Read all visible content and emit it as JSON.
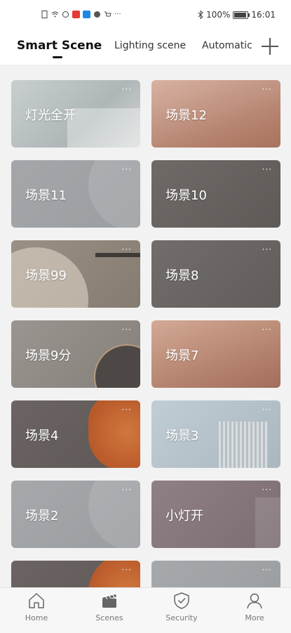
{
  "status_bar": {
    "battery": "100%",
    "time": "16:01",
    "icons": [
      "file-icon",
      "wifi-icon",
      "settings-icon",
      "red-app-icon",
      "blue-app-icon",
      "globe-icon",
      "cart-icon",
      "more-icon",
      "bluetooth-icon"
    ]
  },
  "tabs": [
    {
      "label": "Smart Scene",
      "active": true
    },
    {
      "label": "Lighting scene",
      "active": false
    },
    {
      "label": "Automatic",
      "active": false
    }
  ],
  "cards": [
    {
      "label": "灯光全开",
      "more": "···",
      "bg": "#b9c0c2"
    },
    {
      "label": "场景12",
      "more": "···",
      "bg": "#b88a77"
    },
    {
      "label": "场景11",
      "more": "···",
      "bg": "#9a9ea1"
    },
    {
      "label": "场景10",
      "more": "···",
      "bg": "#66615e"
    },
    {
      "label": "场景99",
      "more": "···",
      "bg": "#8d8378"
    },
    {
      "label": "场景8",
      "more": "···",
      "bg": "#6a6664"
    },
    {
      "label": "场景9分",
      "more": "···",
      "bg": "#8e8985"
    },
    {
      "label": "场景7",
      "more": "···",
      "bg": "#b58b78"
    },
    {
      "label": "场景4",
      "more": "···",
      "bg": "#6b6462"
    },
    {
      "label": "场景3",
      "more": "···",
      "bg": "#b4c2ca"
    },
    {
      "label": "场景2",
      "more": "···",
      "bg": "#a2a6a9"
    },
    {
      "label": "小灯开",
      "more": "···",
      "bg": "#8a7b80"
    },
    {
      "label": "",
      "more": "···",
      "bg": "#6b6462"
    },
    {
      "label": "",
      "more": "···",
      "bg": "#a2a6a9"
    }
  ],
  "bottom_nav": [
    {
      "label": "Home",
      "icon": "home-icon"
    },
    {
      "label": "Scenes",
      "icon": "scenes-icon"
    },
    {
      "label": "Security",
      "icon": "security-shield-icon"
    },
    {
      "label": "More",
      "icon": "person-icon"
    }
  ],
  "colors": {
    "accent": "#111111",
    "background": "#f2f2f2"
  }
}
